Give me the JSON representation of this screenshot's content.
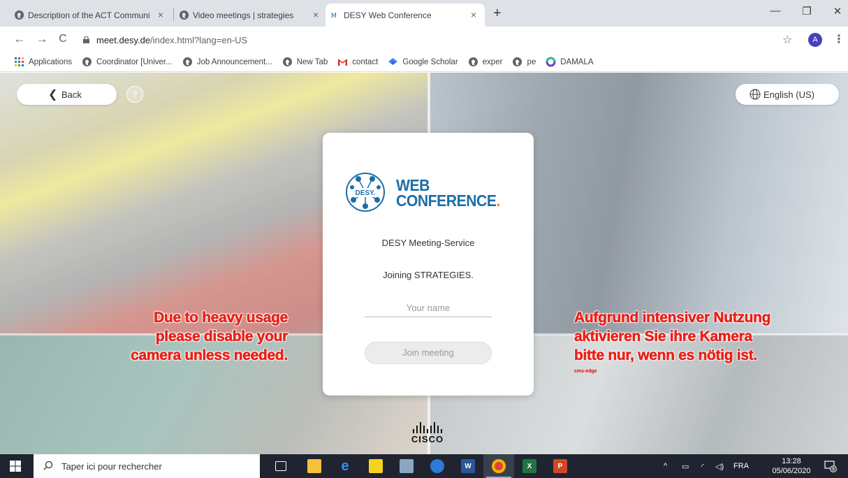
{
  "browser": {
    "tabs": [
      {
        "title": "Description of the ACT Communi",
        "active": false
      },
      {
        "title": "Video meetings | strategies",
        "active": false
      },
      {
        "title": "DESY Web Conference",
        "active": true
      }
    ],
    "tab_close_glyph": "×",
    "new_tab_glyph": "+",
    "window_controls": {
      "minimize": "—",
      "restore": "❐",
      "close": "✕"
    },
    "address": {
      "domain": "meet.desy.de",
      "path": "/index.html?lang=en-US"
    },
    "profile_initial": "A",
    "bookmarks": [
      {
        "label": "Applications",
        "icon": "apps-grid-icon"
      },
      {
        "label": "Coordinator [Univer...",
        "icon": "globe-icon"
      },
      {
        "label": "Job Announcement...",
        "icon": "globe-icon"
      },
      {
        "label": "New Tab",
        "icon": "globe-icon"
      },
      {
        "label": "contact",
        "icon": "gmail-icon"
      },
      {
        "label": "Google Scholar",
        "icon": "scholar-icon"
      },
      {
        "label": "exper",
        "icon": "globe-icon"
      },
      {
        "label": "pe",
        "icon": "globe-icon"
      },
      {
        "label": "DAMALA",
        "icon": "damala-icon"
      }
    ]
  },
  "page": {
    "back_label": "Back",
    "help_glyph": "?",
    "language_label": "English (US)",
    "warning_en": [
      "Due to heavy usage",
      "please disable your",
      "camera unless needed."
    ],
    "warning_de": [
      "Aufgrund intensiver Nutzung",
      "aktivieren Sie ihre Kamera",
      "bitte nur, wenn es nötig ist."
    ],
    "edge_tag": "cms-edge",
    "card": {
      "logo_badge": "DESY.",
      "logo_line1": "WEB",
      "logo_line2": "CONFERENCE",
      "logo_dot": ".",
      "service": "DESY Meeting-Service",
      "joining": "Joining STRATEGIES.",
      "name_placeholder": "Your name",
      "join_label": "Join meeting"
    },
    "footer_brand": "CISCO",
    "colors": {
      "desy_blue": "#1b6fa8",
      "accent_orange": "#f08a1c",
      "warning_red": "#e8231a"
    }
  },
  "taskbar": {
    "search_placeholder": "Taper ici pour rechercher",
    "language": "FRA",
    "time": "13:28",
    "date": "05/06/2020",
    "notification_count": "5"
  }
}
